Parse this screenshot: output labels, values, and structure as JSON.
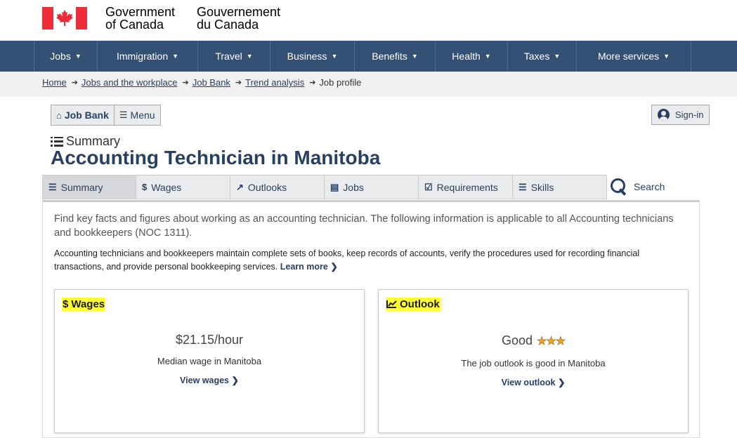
{
  "header": {
    "sig_en_line1": "Government",
    "sig_en_line2": "of Canada",
    "sig_fr_line1": "Gouvernement",
    "sig_fr_line2": "du Canada"
  },
  "menu": [
    {
      "label": "Jobs"
    },
    {
      "label": "Immigration"
    },
    {
      "label": "Travel"
    },
    {
      "label": "Business"
    },
    {
      "label": "Benefits"
    },
    {
      "label": "Health"
    },
    {
      "label": "Taxes"
    },
    {
      "label": "More services"
    }
  ],
  "breadcrumb": [
    "Home",
    "Jobs and the workplace",
    "Job Bank",
    "Trend analysis",
    "Job profile"
  ],
  "jobbank": {
    "home_label": "Job Bank",
    "menu_label": "Menu",
    "signin_label": "Sign-in"
  },
  "page": {
    "section": "Summary",
    "title": "Accounting Technician in Manitoba"
  },
  "tabs": [
    {
      "label": "Summary",
      "icon": "list-icon"
    },
    {
      "label": "Wages",
      "icon": "dollar-icon"
    },
    {
      "label": "Outlooks",
      "icon": "trend-icon"
    },
    {
      "label": "Jobs",
      "icon": "newspaper-icon"
    },
    {
      "label": "Requirements",
      "icon": "checkbox-icon"
    },
    {
      "label": "Skills",
      "icon": "tasks-icon"
    }
  ],
  "search_label": "Search",
  "content": {
    "intro": "Find key facts and figures about working as an accounting technician. The following information is applicable to all Accounting technicians and bookkeepers (NOC 1311).",
    "desc": "Accounting technicians and bookkeepers maintain complete sets of books, keep records of accounts, verify the procedures used for recording financial transactions, and provide personal bookkeeping services.",
    "learn_more": "Learn more"
  },
  "wages_card": {
    "title": "Wages",
    "value": "$21.15/hour",
    "caption": "Median wage in Manitoba",
    "link": "View wages"
  },
  "outlook_card": {
    "title": "Outlook",
    "value": "Good",
    "stars": 3,
    "caption": "The job outlook is good in Manitoba",
    "link": "View outlook"
  },
  "colors": {
    "brand": "#335075",
    "link": "#284162",
    "highlight": "#ffff33",
    "flag_red": "#eb2d37"
  }
}
